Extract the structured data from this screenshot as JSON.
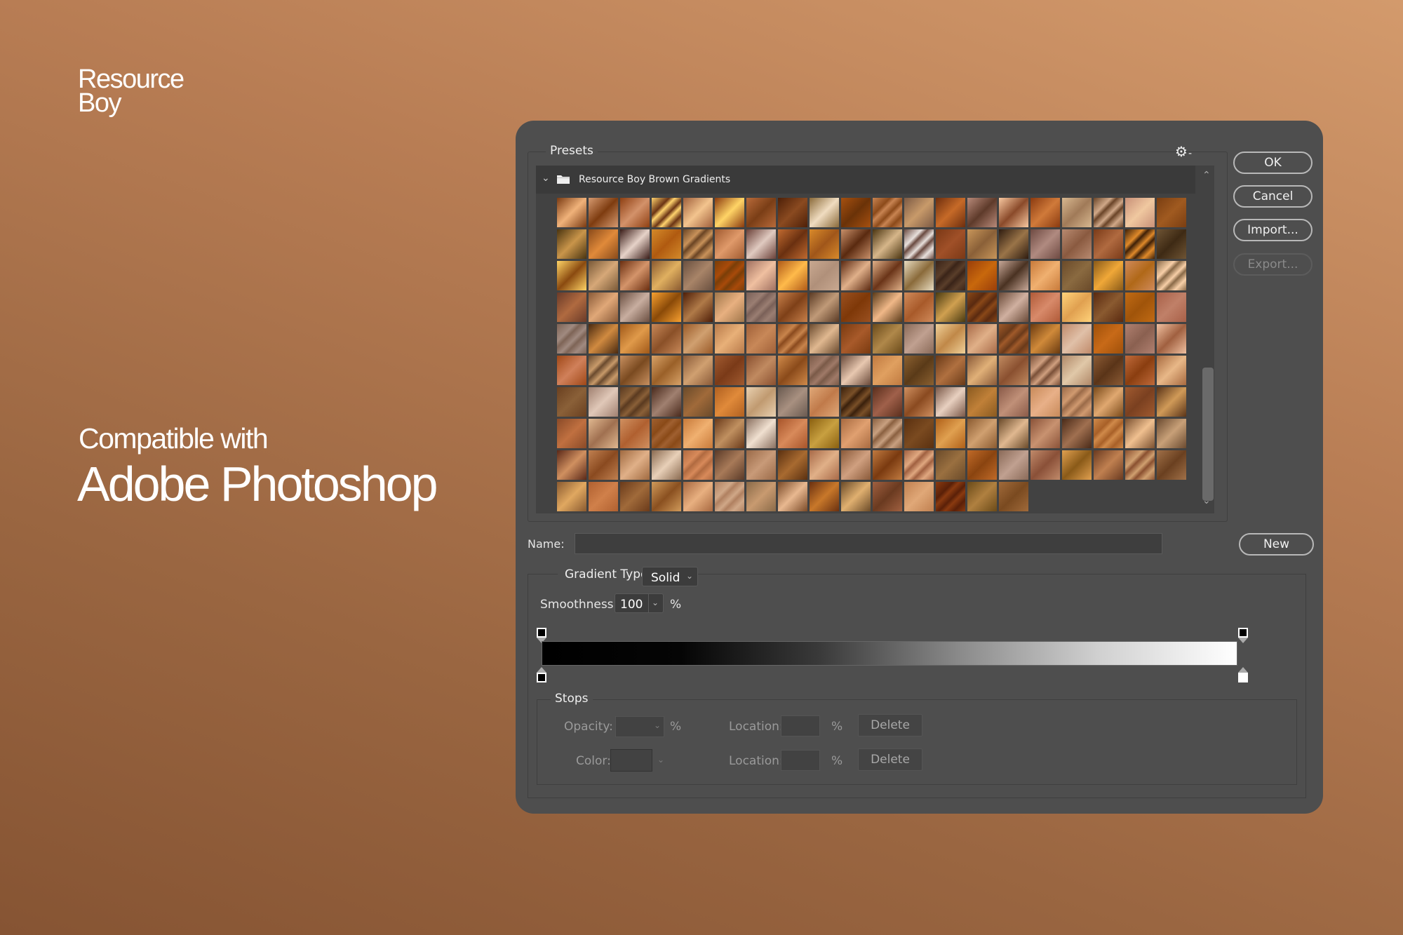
{
  "branding": {
    "line1": "Resource",
    "line2": "Boy",
    "compatible_with": "Compatible with",
    "product": "Adobe Photoshop"
  },
  "dialog": {
    "presets": {
      "label": "Presets",
      "gear_icon": "gear-icon",
      "folder": {
        "name": "Resource Boy Brown Gradients",
        "expanded": true
      },
      "grid": {
        "columns": 20,
        "rows": 10,
        "palette": [
          [
            "#7a3a12",
            "#f0b27a"
          ],
          [
            "#d69a70",
            "#7e3c10"
          ],
          [
            "#8e3f12",
            "#d3926a"
          ],
          [
            "#ffd36e",
            "#6b3414"
          ],
          [
            "#a0603c",
            "#f3c48e"
          ],
          [
            "#8a3a0e",
            "#ffd466"
          ],
          [
            "#b86a3a",
            "#7a3e16"
          ],
          [
            "#4e2008",
            "#8a4a20"
          ],
          [
            "#8a6a3a",
            "#f0dcc0"
          ],
          [
            "#a65010",
            "#6a3208"
          ],
          [
            "#c88452",
            "#8c4a1a"
          ],
          [
            "#7c5a44",
            "#c89a6a"
          ],
          [
            "#6e2e0e",
            "#c66a28"
          ],
          [
            "#b88a7a",
            "#5e3a2a"
          ],
          [
            "#f8c8a0",
            "#8a4a2a"
          ],
          [
            "#8a3a10",
            "#d07a3a"
          ],
          [
            "#d8b890",
            "#a07a58"
          ],
          [
            "#6a4428",
            "#d0a888"
          ],
          [
            "#c89078",
            "#f0c8a0"
          ],
          [
            "#7a3e12",
            "#a05a20"
          ],
          [
            "#4a3410",
            "#c9954a"
          ],
          [
            "#8a4a1a",
            "#e08a3a"
          ],
          [
            "#3a1c18",
            "#e6d2c8"
          ],
          [
            "#d48a2a",
            "#b05a10"
          ],
          [
            "#6a4424",
            "#c8925a"
          ],
          [
            "#a05a30",
            "#e09a6a"
          ],
          [
            "#6a4038",
            "#e0cac0"
          ],
          [
            "#c06a30",
            "#6a3010"
          ],
          [
            "#d98a2a",
            "#a0561a"
          ],
          [
            "#c8906a",
            "#5a2a10"
          ],
          [
            "#4a3410",
            "#d6b68a"
          ],
          [
            "#6a4a40",
            "#e8e0dc"
          ],
          [
            "#7a3816",
            "#a05028"
          ],
          [
            "#c8965a",
            "#8a6038"
          ],
          [
            "#2e1c10",
            "#9a7448"
          ],
          [
            "#6e4a42",
            "#b08a80"
          ],
          [
            "#b88a70",
            "#8a5a40"
          ],
          [
            "#7a3a18",
            "#b06a40"
          ],
          [
            "#3e2008",
            "#e08a2a"
          ],
          [
            "#6e5434",
            "#3e2a14"
          ],
          [
            "#ffd466",
            "#8a4a10"
          ],
          [
            "#7a5a38",
            "#d6a878"
          ],
          [
            "#6a2e10",
            "#d4946a"
          ],
          [
            "#8a5a30",
            "#e0b060"
          ],
          [
            "#6a5040",
            "#a88468"
          ],
          [
            "#7a3e08",
            "#a84a0a"
          ],
          [
            "#a07060",
            "#f0c0a0"
          ],
          [
            "#b05a18",
            "#ffba4a"
          ],
          [
            "#c8a890",
            "#b0907a"
          ],
          [
            "#5a2810",
            "#e0b08a"
          ],
          [
            "#e0b088",
            "#6a3418"
          ],
          [
            "#e8dcc0",
            "#8a6a3a"
          ],
          [
            "#3a2418",
            "#5a3e2a"
          ],
          [
            "#9a3e0a",
            "#c8680c"
          ],
          [
            "#c8a898",
            "#4a3222"
          ],
          [
            "#c87a3a",
            "#f0b070"
          ],
          [
            "#6a4a2a",
            "#8a6a40"
          ],
          [
            "#8a5a18",
            "#f0a838"
          ],
          [
            "#d08a5a",
            "#b06818"
          ],
          [
            "#8a6a48",
            "#f8d0a8"
          ],
          [
            "#6a3a28",
            "#b06a40"
          ],
          [
            "#8a5a38",
            "#e0a878"
          ],
          [
            "#6a4e40",
            "#c8aea0"
          ],
          [
            "#f8a030",
            "#8a4a08"
          ],
          [
            "#4e1e08",
            "#b07a48"
          ],
          [
            "#a0764a",
            "#e8b080"
          ],
          [
            "#7a6058",
            "#9a7e72"
          ],
          [
            "#c8804a",
            "#7e4018"
          ],
          [
            "#5a3a24",
            "#c09a78"
          ],
          [
            "#9a5020",
            "#7e3808"
          ],
          [
            "#5a3a18",
            "#f0b888"
          ],
          [
            "#d08a5a",
            "#a85a2a"
          ],
          [
            "#4a3a10",
            "#d0a050"
          ],
          [
            "#8a4818",
            "#5a2a10"
          ],
          [
            "#6a4a38",
            "#d0b0a0"
          ],
          [
            "#b05a38",
            "#d88a6a"
          ],
          [
            "#ffd27a",
            "#e0a050"
          ],
          [
            "#5a2a10",
            "#8a5a30"
          ],
          [
            "#c06a14",
            "#a0540a"
          ],
          [
            "#a86048",
            "#c08068"
          ],
          [
            "#7e6456",
            "#a08a80"
          ],
          [
            "#4a2a10",
            "#d08a40"
          ],
          [
            "#a05818",
            "#e09a4a"
          ],
          [
            "#c88858",
            "#8a5028"
          ],
          [
            "#9a5a28",
            "#d0a070"
          ],
          [
            "#b87a4a",
            "#e8b078"
          ],
          [
            "#a06038",
            "#c88858"
          ],
          [
            "#8a4a1e",
            "#c8844c"
          ],
          [
            "#6a4a2e",
            "#e0b890"
          ],
          [
            "#7a3a10",
            "#a85a2a"
          ],
          [
            "#6a4a1a",
            "#b0884a"
          ],
          [
            "#8a6a58",
            "#c0a090"
          ],
          [
            "#f0d098",
            "#c08848"
          ],
          [
            "#a86a48",
            "#e0b088"
          ],
          [
            "#a05a2a",
            "#6a3a1a"
          ],
          [
            "#6a3a10",
            "#d08a3a"
          ],
          [
            "#c08a6a",
            "#e0c0a8"
          ],
          [
            "#a0500a",
            "#c86a18"
          ],
          [
            "#b08070",
            "#8a6050"
          ],
          [
            "#f0c0a0",
            "#a06040"
          ],
          [
            "#a04818",
            "#d0805a"
          ],
          [
            "#6a4a2e",
            "#c89a6a"
          ],
          [
            "#c89060",
            "#7a4a20"
          ],
          [
            "#d8a268",
            "#9a6028"
          ],
          [
            "#8a5a38",
            "#d0a070"
          ],
          [
            "#a05a30",
            "#7a3a18"
          ],
          [
            "#8a5030",
            "#c08a60"
          ],
          [
            "#d08a4a",
            "#8a4a1a"
          ],
          [
            "#7a5a48",
            "#a07a68"
          ],
          [
            "#6a4a3a",
            "#e8c8b0"
          ],
          [
            "#c07a40",
            "#e0a060"
          ],
          [
            "#8a6030",
            "#5a3a18"
          ],
          [
            "#6a3a18",
            "#b07040"
          ],
          [
            "#8a5a38",
            "#e0b078"
          ],
          [
            "#c08a60",
            "#8a5030"
          ],
          [
            "#7a5038",
            "#d0a080"
          ],
          [
            "#b08868",
            "#e0c8a8"
          ],
          [
            "#8a5a34",
            "#5a3418"
          ],
          [
            "#c06a3a",
            "#8a3e10"
          ],
          [
            "#a86a40",
            "#e8b888"
          ],
          [
            "#6a4020",
            "#8a6038"
          ],
          [
            "#a08070",
            "#e0c8b8"
          ],
          [
            "#5a3a20",
            "#8a6038"
          ],
          [
            "#4a2a1c",
            "#a08070"
          ],
          [
            "#6a4a2a",
            "#a06a3a"
          ],
          [
            "#b06020",
            "#e08a3a"
          ],
          [
            "#e8d0b0",
            "#c09a70"
          ],
          [
            "#6a5a50",
            "#a89080"
          ],
          [
            "#e0a878",
            "#c07a4a"
          ],
          [
            "#3a200c",
            "#7a5028"
          ],
          [
            "#5a2e1c",
            "#a0604a"
          ],
          [
            "#d09060",
            "#8a4a20"
          ],
          [
            "#7a5848",
            "#e8d0c0"
          ],
          [
            "#8a5a20",
            "#c08038"
          ],
          [
            "#8a5a48",
            "#c09078"
          ],
          [
            "#c88a5a",
            "#e8b088"
          ],
          [
            "#9a6a48",
            "#d09a70"
          ],
          [
            "#7a4a1a",
            "#e0a870"
          ],
          [
            "#a05a30",
            "#7a4020"
          ],
          [
            "#5a3418",
            "#d09a58"
          ],
          [
            "#8a4a28",
            "#c07040"
          ],
          [
            "#e0b890",
            "#a07050"
          ],
          [
            "#d09060",
            "#b06030"
          ],
          [
            "#a06030",
            "#8a4a18"
          ],
          [
            "#c87a3a",
            "#f0b070"
          ],
          [
            "#6a3a1a",
            "#c09060"
          ],
          [
            "#8a7060",
            "#f0e0d0"
          ],
          [
            "#a8542a",
            "#d88a5a"
          ],
          [
            "#8a6010",
            "#c8a040"
          ],
          [
            "#a86a40",
            "#e0a070"
          ],
          [
            "#8a6040",
            "#c8a080"
          ],
          [
            "#5a3010",
            "#7a4a20"
          ],
          [
            "#b06018",
            "#e0a050"
          ],
          [
            "#8a5a30",
            "#d0a070"
          ],
          [
            "#6a4a2a",
            "#e0b890"
          ],
          [
            "#8a5238",
            "#c89270"
          ],
          [
            "#4a2a18",
            "#a07050"
          ],
          [
            "#d08a4a",
            "#a86028"
          ],
          [
            "#7a5030",
            "#f0c090"
          ],
          [
            "#6a4a30",
            "#c8a078"
          ],
          [
            "#5a2818",
            "#d09060"
          ],
          [
            "#c08050",
            "#8a4a20"
          ],
          [
            "#a06a40",
            "#e0b088"
          ],
          [
            "#8a6a50",
            "#e8d0b8"
          ],
          [
            "#b06a40",
            "#d88a5a"
          ],
          [
            "#5a3a28",
            "#a87a58"
          ],
          [
            "#9a6a48",
            "#c89a78"
          ],
          [
            "#5a3010",
            "#a86a30"
          ],
          [
            "#a86a48",
            "#e0b088"
          ],
          [
            "#8a5a3a",
            "#d0a080"
          ],
          [
            "#c07a40",
            "#7a3a10"
          ],
          [
            "#a06040",
            "#e0a880"
          ],
          [
            "#6a4a2a",
            "#9a7040"
          ],
          [
            "#c06a28",
            "#8a4410"
          ],
          [
            "#8a6a58",
            "#c0a090"
          ],
          [
            "#c08a6a",
            "#8a5038"
          ],
          [
            "#e0a050",
            "#8a5a18"
          ],
          [
            "#6a3a20",
            "#c08050"
          ],
          [
            "#8a5030",
            "#d0a070"
          ],
          [
            "#a07048",
            "#6a4020"
          ],
          [
            "#8a5a30",
            "#e0a860"
          ],
          [
            "#b06030",
            "#d0804a"
          ],
          [
            "#6a3a1a",
            "#a06a3a"
          ],
          [
            "#d09a5a",
            "#8a5020"
          ],
          [
            "#a86840",
            "#e8b080"
          ],
          [
            "#b08060",
            "#d0a888"
          ],
          [
            "#8a6a48",
            "#c89a70"
          ],
          [
            "#7a4a28",
            "#e8b890"
          ],
          [
            "#6a3010",
            "#c8782a"
          ],
          [
            "#6a4a28",
            "#e0b070"
          ],
          [
            "#a06040",
            "#6a3a20"
          ],
          [
            "#c08050",
            "#e0a878"
          ],
          [
            "#8a3a10",
            "#5a2008"
          ],
          [
            "#6a4a18",
            "#b08040"
          ],
          [
            "#a06a3a",
            "#7a4a20"
          ]
        ]
      }
    },
    "buttons": {
      "ok": "OK",
      "cancel": "Cancel",
      "import": "Import...",
      "export": "Export...",
      "new": "New"
    },
    "name": {
      "label": "Name:",
      "value": ""
    },
    "gradient_type": {
      "label": "Gradient Type:",
      "value": "Solid"
    },
    "smoothness": {
      "label": "Smoothness:",
      "value": "100",
      "unit": "%"
    },
    "gradient_preview": {
      "start_color": "#000000",
      "end_color": "#ffffff"
    },
    "stops": {
      "label": "Stops",
      "opacity_label": "Opacity:",
      "opacity_unit": "%",
      "color_label": "Color:",
      "location_label": "Location:",
      "location_unit": "%",
      "delete_label": "Delete"
    }
  }
}
